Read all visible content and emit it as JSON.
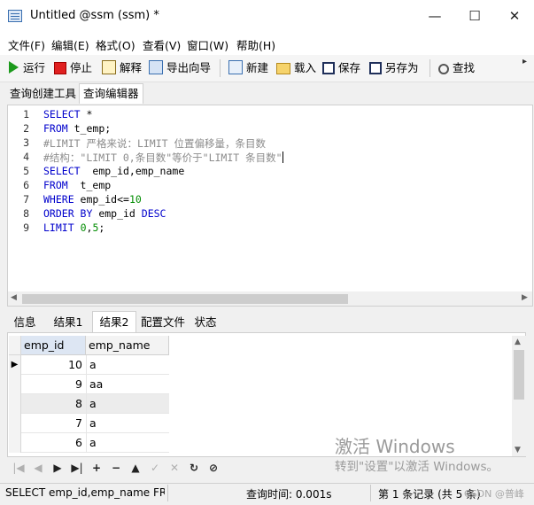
{
  "window": {
    "title": "Untitled @ssm (ssm) *",
    "minimize": "—",
    "maximize": "☐",
    "close": "✕"
  },
  "menu": [
    "文件(F)",
    "编辑(E)",
    "格式(O)",
    "查看(V)",
    "窗口(W)",
    "帮助(H)"
  ],
  "toolbar": {
    "run": "运行",
    "stop": "停止",
    "explain": "解释",
    "export_wizard": "导出向导",
    "new": "新建",
    "load": "载入",
    "save": "保存",
    "save_as": "另存为",
    "find": "查找"
  },
  "query_tabs": [
    "查询创建工具",
    "查询编辑器"
  ],
  "editor": {
    "line_numbers": [
      "1",
      "2",
      "3",
      "4",
      "5",
      "6",
      "7",
      "8",
      "9"
    ],
    "lines": [
      [
        "SELECT",
        " *"
      ],
      [
        "FROM",
        " t_emp;"
      ],
      [
        "#LIMIT 严格来说：LIMIT 位置偏移量，条目数"
      ],
      [
        "#结构：\"LIMIT 0,条目数\"等价于\"LIMIT 条目数\""
      ],
      [
        "SELECT",
        "  emp_id,emp_name"
      ],
      [
        "FROM",
        "  t_emp"
      ],
      [
        "WHERE",
        " emp_id<=",
        "10"
      ],
      [
        "ORDER BY",
        " emp_id ",
        "DESC"
      ],
      [
        "LIMIT",
        " ",
        "0",
        ",",
        "5",
        ";"
      ]
    ]
  },
  "result_tabs": [
    "信息",
    "结果1",
    "结果2",
    "配置文件",
    "状态"
  ],
  "grid": {
    "columns": [
      "emp_id",
      "emp_name"
    ],
    "rows": [
      [
        "10",
        "a"
      ],
      [
        "9",
        "aa"
      ],
      [
        "8",
        "a"
      ],
      [
        "7",
        "a"
      ],
      [
        "6",
        "a"
      ]
    ],
    "current_row_marker": "▶"
  },
  "nav": [
    "|◀",
    "◀",
    "▶",
    "▶|",
    "+",
    "−",
    "▲",
    "✓",
    "✕",
    "↻",
    "⊘"
  ],
  "status": {
    "sql": "SELECT  emp_id,emp_name FRO",
    "query_time": "查询时间: 0.001s",
    "records": "第 1 条记录 (共 5 条)"
  },
  "watermark": {
    "line1": "激活 Windows",
    "line2": "转到\"设置\"以激活 Windows。",
    "csdn": "CSDN @普峰"
  },
  "colors": {
    "keyword": "#0000cc",
    "comment": "#8c8c8c",
    "number": "#008c00"
  }
}
